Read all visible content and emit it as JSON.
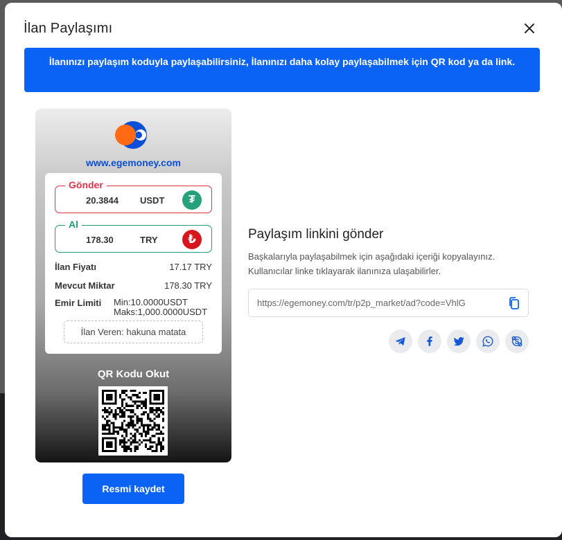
{
  "modal": {
    "title": "İlan Paylaşımı",
    "banner": "İlanınızı paylaşım koduyla paylaşabilirsiniz, İlanınızı daha kolay paylaşabilmek için QR kod ya da link."
  },
  "card": {
    "site": "www.egemoney.com",
    "send": {
      "label": "Gönder",
      "amount": "20.3844",
      "currency": "USDT",
      "icon": "tether-icon"
    },
    "receive": {
      "label": "Al",
      "amount": "178.30",
      "currency": "TRY",
      "icon": "lira-icon"
    },
    "price_label": "İlan Fiyatı",
    "price_value": "17.17 TRY",
    "available_label": "Mevcut Miktar",
    "available_value": "178.30 TRY",
    "limit_label": "Emir Limiti",
    "limit_min": "Min:10.0000USDT",
    "limit_max": "Maks:1,000.0000USDT",
    "seller": "İlan Veren: hakuna matata",
    "qr_title": "QR Kodu Okut"
  },
  "save_button": "Resmi kaydet",
  "share": {
    "title": "Paylaşım linkini gönder",
    "description": "Başkalarıyla paylaşabilmek için aşağıdaki içeriği kopyalayınız. Kullanıcılar linke tıklayarak ilanınıza ulaşabilirler.",
    "link": "https://egemoney.com/tr/p2p_market/ad?code=VhlG",
    "socials": [
      "telegram-icon",
      "facebook-icon",
      "twitter-icon",
      "whatsapp-icon",
      "skype-icon"
    ]
  },
  "colors": {
    "primary": "#0b63f5",
    "send": "#e2324a",
    "receive": "#1f9b77",
    "site": "#0b4fd8"
  }
}
